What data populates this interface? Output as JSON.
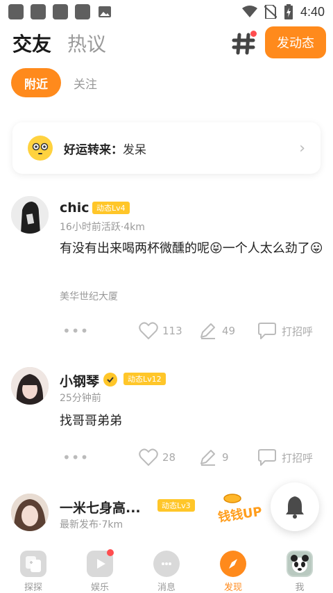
{
  "status_bar": {
    "time": "4:40"
  },
  "header": {
    "tab_active": "交友",
    "tab_inactive": "热议",
    "post_button": "发动态",
    "hash_icon": "hashtag-icon"
  },
  "subtabs": {
    "active": "附近",
    "other": "关注"
  },
  "banner": {
    "title": "好运转来：",
    "text": "发呆",
    "emoji": "😳"
  },
  "posts": [
    {
      "username": "chic",
      "level": "动态Lv4",
      "meta": "16小时前活跃·4km",
      "content": "有没有出来喝两杯微醺的呢😝一个人太么劲了😛",
      "location": "美华世纪大厦",
      "likes": "113",
      "comments": "49",
      "greet": "打招呼"
    },
    {
      "username": "小钢琴",
      "level": "动态Lv12",
      "meta": "25分钟前",
      "content": "找哥哥弟弟",
      "likes": "28",
      "comments": "9",
      "greet": "打招呼"
    },
    {
      "username": "一米七身高...",
      "level": "动态Lv3",
      "meta": "最新发布·7km"
    }
  ],
  "promo": {
    "text": "钱钱UP"
  },
  "bottom_nav": [
    {
      "label": "探探",
      "icon": "cards-icon"
    },
    {
      "label": "娱乐",
      "icon": "play-icon"
    },
    {
      "label": "消息",
      "icon": "chat-icon"
    },
    {
      "label": "发现",
      "icon": "compass-icon"
    },
    {
      "label": "我",
      "icon": "avatar"
    }
  ],
  "colors": {
    "accent": "#ff8a1c",
    "badge": "#ffc629",
    "dot": "#ff4d4f"
  }
}
